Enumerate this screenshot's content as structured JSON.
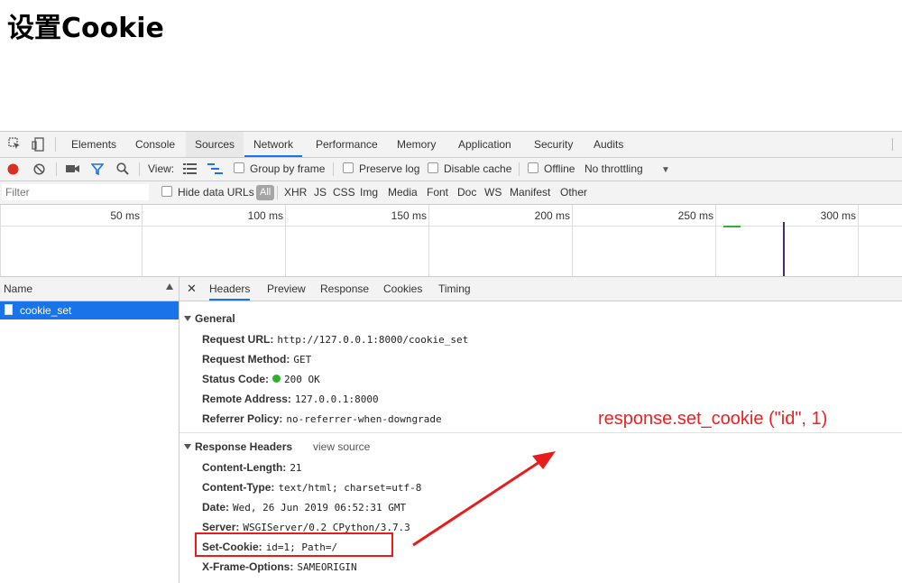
{
  "page": {
    "title": "设置Cookie"
  },
  "tabs": [
    "Elements",
    "Console",
    "Sources",
    "Network",
    "Performance",
    "Memory",
    "Application",
    "Security",
    "Audits"
  ],
  "toolbar": {
    "view_label": "View:",
    "group_by_frame": "Group by frame",
    "preserve_log": "Preserve log",
    "disable_cache": "Disable cache",
    "offline": "Offline",
    "throttling": "No throttling"
  },
  "filterbar": {
    "placeholder": "Filter",
    "hide_data_urls": "Hide data URLs",
    "types": [
      "All",
      "XHR",
      "JS",
      "CSS",
      "Img",
      "Media",
      "Font",
      "Doc",
      "WS",
      "Manifest",
      "Other"
    ]
  },
  "timeline": {
    "ticks": [
      "50 ms",
      "100 ms",
      "150 ms",
      "200 ms",
      "250 ms",
      "300 ms"
    ]
  },
  "requests": {
    "header": "Name",
    "items": [
      "cookie_set"
    ]
  },
  "details": {
    "tabs": [
      "Headers",
      "Preview",
      "Response",
      "Cookies",
      "Timing"
    ],
    "general": {
      "title": "General",
      "items": [
        {
          "k": "Request URL:",
          "v": "http://127.0.0.1:8000/cookie_set"
        },
        {
          "k": "Request Method:",
          "v": "GET"
        },
        {
          "k": "Status Code:",
          "v": "200 OK"
        },
        {
          "k": "Remote Address:",
          "v": "127.0.0.1:8000"
        },
        {
          "k": "Referrer Policy:",
          "v": "no-referrer-when-downgrade"
        }
      ]
    },
    "response_headers": {
      "title": "Response Headers",
      "view_source": "view source",
      "items": [
        {
          "k": "Content-Length:",
          "v": "21"
        },
        {
          "k": "Content-Type:",
          "v": "text/html; charset=utf-8"
        },
        {
          "k": "Date:",
          "v": "Wed, 26 Jun 2019 06:52:31 GMT"
        },
        {
          "k": "Server:",
          "v": "WSGIServer/0.2 CPython/3.7.3"
        },
        {
          "k": "Set-Cookie:",
          "v": "id=1; Path=/"
        },
        {
          "k": "X-Frame-Options:",
          "v": "SAMEORIGIN"
        }
      ]
    }
  },
  "annotation": {
    "text": "response.set_cookie (\"id\", 1)",
    "color": "#f02020"
  },
  "colors": {
    "accent": "#1a73e8",
    "record": "#d93025",
    "status_ok": "#2bb32b"
  }
}
